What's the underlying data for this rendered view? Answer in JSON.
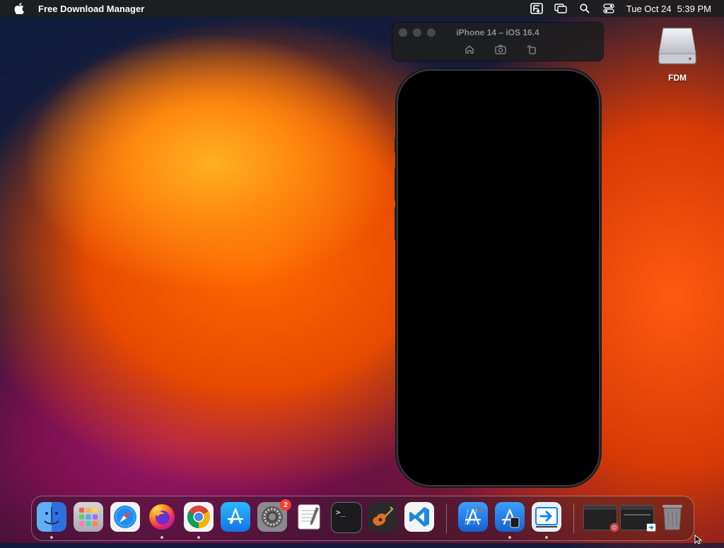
{
  "menubar": {
    "app_name": "Free Download Manager",
    "date": "Tue Oct 24",
    "time": "5:39 PM"
  },
  "simulator": {
    "title": "iPhone 14 – iOS 16.4"
  },
  "desktop": {
    "drive_label": "FDM"
  },
  "dock": {
    "system_settings_badge": "2",
    "terminal_prompt": ">_"
  },
  "colors": {
    "menubar_bg": "#1e1e1e",
    "badge_red": "#ff3b30",
    "vscode_blue": "#1e8ad6",
    "appstore_blue": "#1a9bf0"
  }
}
